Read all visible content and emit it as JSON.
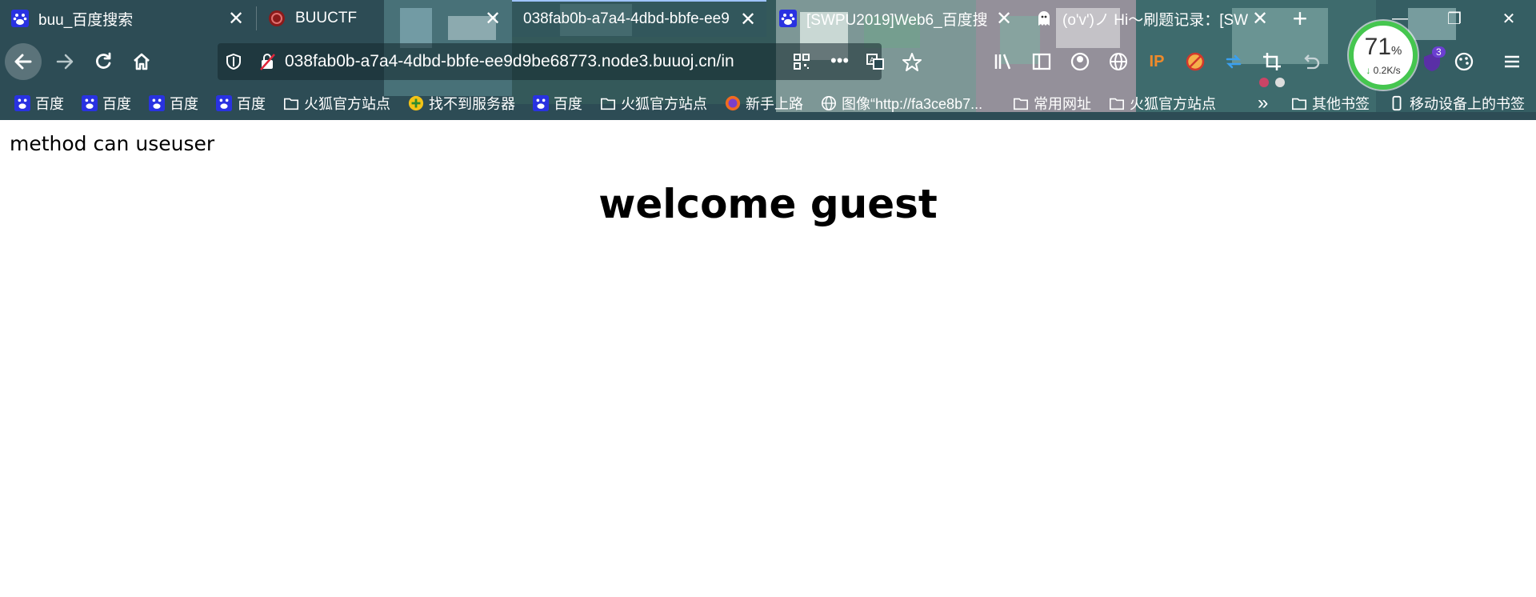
{
  "tabs": [
    {
      "title": "buu_百度搜索",
      "favicon": "baidu-icon"
    },
    {
      "title": "BUUCTF",
      "favicon": "buuctf-icon"
    },
    {
      "title": "038fab0b-a7a4-4dbd-bbfe-ee9",
      "favicon": "none",
      "active": true
    },
    {
      "title": "[SWPU2019]Web6_百度搜",
      "favicon": "baidu-icon"
    },
    {
      "title": "(o'v')ノ Hi～刷题记录：[SW",
      "favicon": "ghost-icon"
    }
  ],
  "navbar": {
    "url": "038fab0b-a7a4-4dbd-bbfe-ee9d9be68773.node3.buuoj.cn/in"
  },
  "speed_widget": {
    "percent": "71",
    "percent_sign": "%",
    "rate": "0.2K/s"
  },
  "extension_badge": "3",
  "bookmarks": [
    {
      "label": "百度",
      "icon": "baidu-icon"
    },
    {
      "label": "百度",
      "icon": "baidu-icon"
    },
    {
      "label": "百度",
      "icon": "baidu-icon"
    },
    {
      "label": "百度",
      "icon": "baidu-icon"
    },
    {
      "label": "火狐官方站点",
      "icon": "folder-icon"
    },
    {
      "label": "找不到服务器",
      "icon": "plus-circle-icon"
    },
    {
      "label": "百度",
      "icon": "baidu-icon"
    },
    {
      "label": "火狐官方站点",
      "icon": "folder-icon"
    },
    {
      "label": "新手上路",
      "icon": "firefox-icon"
    },
    {
      "label": "图像“http://fa3ce8b7...",
      "icon": "globe-icon"
    },
    {
      "label": "常用网址",
      "icon": "folder-icon"
    },
    {
      "label": "火狐官方站点",
      "icon": "folder-icon"
    },
    {
      "label": "其他书签",
      "icon": "folder-icon"
    },
    {
      "label": "移动设备上的书签",
      "icon": "mobile-icon"
    }
  ],
  "content": {
    "method_text": "method can useuser",
    "heading": "welcome guest"
  },
  "colors": {
    "baidu_blue": "#2932e1",
    "speed_ring": "#45c64f",
    "page_bg": "#ffffff",
    "text": "#000000"
  }
}
